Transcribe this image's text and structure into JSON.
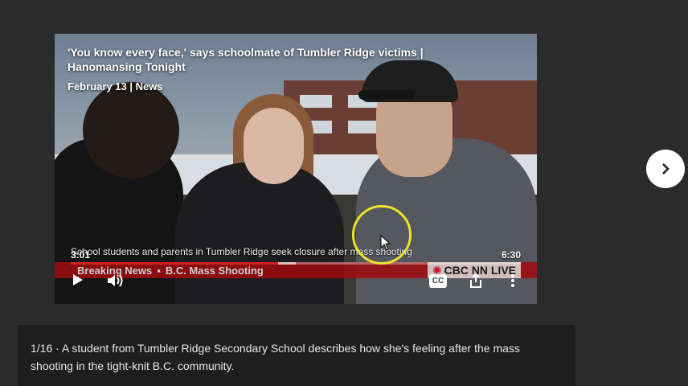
{
  "video": {
    "title": "'You know every face,' says schoolmate of Tumbler Ridge victims | Hanomansing Tonight",
    "meta": "February 13 | News",
    "caption": "School students and parents in Tumbler Ridge seek closure after mass shooting",
    "current_time": "3:01",
    "duration": "6:30",
    "progress_fraction": 0.46,
    "loaded_fraction": 0.5,
    "ticker_items": [
      "Breaking News",
      "B.C. Mass Shooting"
    ],
    "channel_logo": "CBC NN LIVE"
  },
  "controls": {
    "play_icon": "play-icon",
    "volume_icon": "volume-icon",
    "cc_label": "CC",
    "share_icon": "share-icon",
    "more_icon": "more-icon"
  },
  "navigation": {
    "next_icon": "chevron-right-icon"
  },
  "description": {
    "counter": "1/16",
    "text": "A student from Tumbler Ridge Secondary School describes how she's feeling after the mass shooting in the tight-knit B.C. community."
  },
  "colors": {
    "background": "#2b2b2b",
    "progress_played": "#d11f26",
    "ticker": "#a00a0e",
    "cursor_highlight": "#f0e22a"
  }
}
